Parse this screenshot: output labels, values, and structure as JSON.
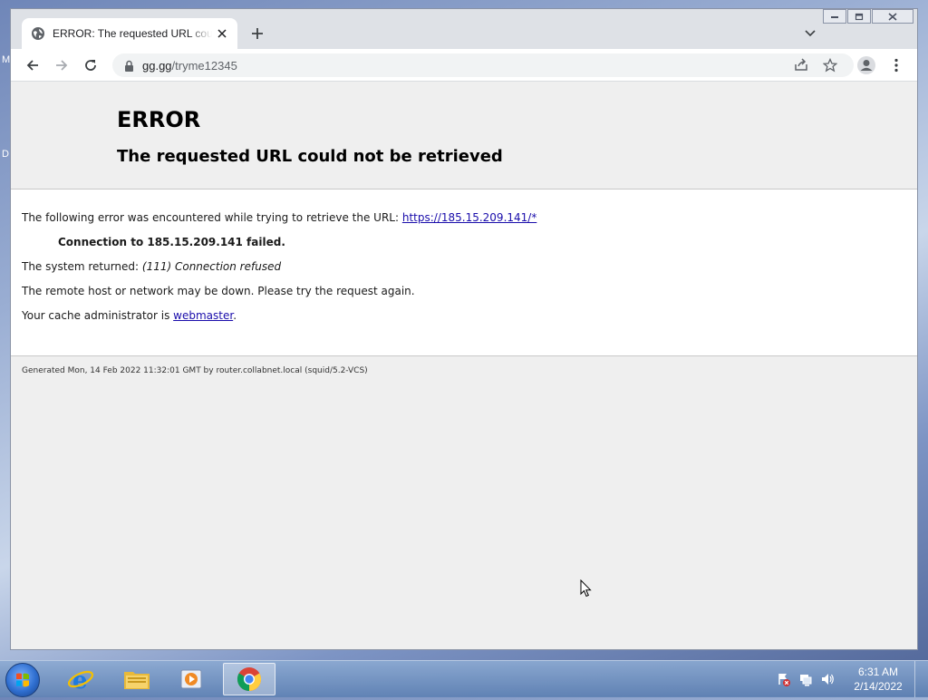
{
  "browser": {
    "tab_title": "ERROR: The requested URL could not be retrieved",
    "address": {
      "host": "gg.gg",
      "path": "/tryme12345"
    }
  },
  "page": {
    "heading": "ERROR",
    "subheading": "The requested URL could not be retrieved",
    "line1_prefix": "The following error was encountered while trying to retrieve the URL: ",
    "line1_link": "https://185.15.209.141/*",
    "line2": "Connection to 185.15.209.141 failed.",
    "line3_prefix": "The system returned: ",
    "line3_error": "(111) Connection refused",
    "line4": "The remote host or network may be down. Please try the request again.",
    "line5_prefix": "Your cache administrator is ",
    "line5_link": "webmaster",
    "line5_suffix": ".",
    "footer": "Generated Mon, 14 Feb 2022 11:32:01 GMT by router.collabnet.local (squid/5.2-VCS)"
  },
  "desktop": {
    "edge_letters": [
      "M",
      "D"
    ]
  },
  "taskbar": {
    "apps": [
      "internet-explorer-icon",
      "file-explorer-icon",
      "media-player-icon",
      "chrome-icon"
    ],
    "clock_time": "6:31 AM",
    "clock_date": "2/14/2022"
  },
  "colors": {
    "link": "#1a0dab",
    "page_bg": "#efefef",
    "tab_strip": "#dee1e6"
  }
}
